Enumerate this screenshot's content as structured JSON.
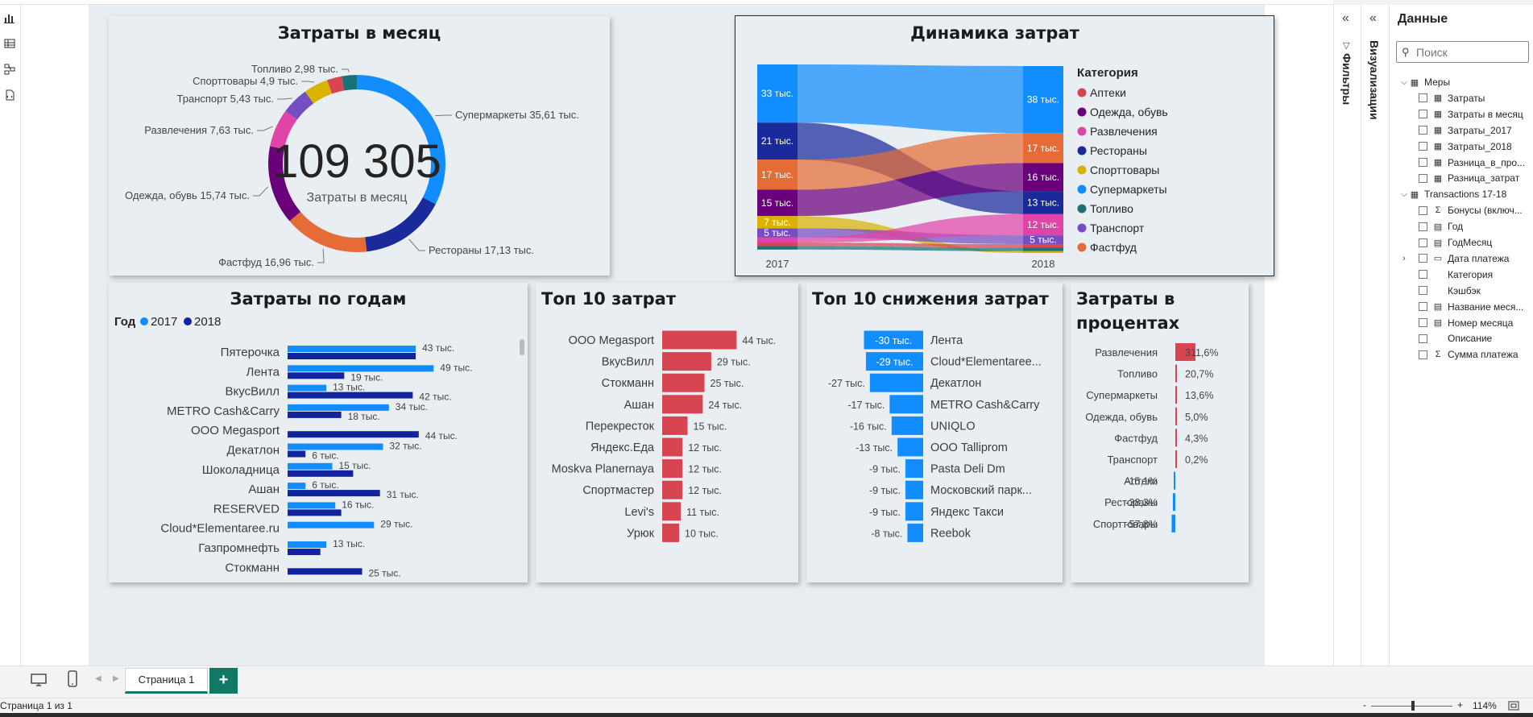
{
  "colors": {
    "Аптеки": "#d64550",
    "Одежда, обувь": "#6b007b",
    "Развлечения": "#e044a7",
    "Рестораны": "#1a2a9b",
    "Спорттовары": "#d9b300",
    "Супермаркеты": "#118dff",
    "Топливо": "#197278",
    "Транспорт": "#744ec2",
    "Фастфуд": "#e66c37",
    "y2017": "#118dff",
    "y2018": "#12239e",
    "top10": "#d64550",
    "decrease": "#118dff"
  },
  "donut": {
    "title": "Затраты в месяц",
    "total": "109 305",
    "subtitle": "Затраты в месяц",
    "slices": [
      {
        "category": "Супермаркеты",
        "value": 35.61,
        "label": "Супермаркеты 35,61 тыс."
      },
      {
        "category": "Рестораны",
        "value": 17.13,
        "label": "Рестораны 17,13 тыс."
      },
      {
        "category": "Фастфуд",
        "value": 16.96,
        "label": "Фастфуд 16,96 тыс."
      },
      {
        "category": "Одежда, обувь",
        "value": 15.74,
        "label": "Одежда, обувь 15,74 тыс."
      },
      {
        "category": "Развлечения",
        "value": 7.63,
        "label": "Развлечения 7,63 тыс."
      },
      {
        "category": "Транспорт",
        "value": 5.43,
        "label": "Транспорт 5,43 тыс."
      },
      {
        "category": "Спорттовары",
        "value": 4.9,
        "label": "Спорттовары 4,9 тыс."
      },
      {
        "category": "Аптеки",
        "value": 2.98,
        "label": ""
      },
      {
        "category": "Топливо",
        "value": 2.98,
        "label": "Топливо 2,98 тыс."
      }
    ]
  },
  "sankey": {
    "title": "Динамика затрат",
    "legend_title": "Категория",
    "legend": [
      "Аптеки",
      "Одежда, обувь",
      "Развлечения",
      "Рестораны",
      "Спорттовары",
      "Супермаркеты",
      "Топливо",
      "Транспорт",
      "Фастфуд"
    ],
    "year_left": "2017",
    "year_right": "2018",
    "left_nodes": [
      {
        "category": "Супермаркеты",
        "value": 33,
        "label": "33 тыс."
      },
      {
        "category": "Рестораны",
        "value": 21,
        "label": "21 тыс."
      },
      {
        "category": "Фастфуд",
        "value": 17,
        "label": "17 тыс."
      },
      {
        "category": "Одежда, обувь",
        "value": 15,
        "label": "15 тыс."
      },
      {
        "category": "Спорттовары",
        "value": 7,
        "label": "7 тыс."
      },
      {
        "category": "Транспорт",
        "value": 5,
        "label": "5 тыс."
      },
      {
        "category": "Развлечения",
        "value": 3,
        "label": ""
      },
      {
        "category": "Аптеки",
        "value": 2,
        "label": ""
      },
      {
        "category": "Топливо",
        "value": 2,
        "label": ""
      }
    ],
    "right_nodes": [
      {
        "category": "Супермаркеты",
        "value": 38,
        "label": "38 тыс."
      },
      {
        "category": "Фастфуд",
        "value": 17,
        "label": "17 тыс."
      },
      {
        "category": "Одежда, обувь",
        "value": 16,
        "label": "16 тыс."
      },
      {
        "category": "Рестораны",
        "value": 13,
        "label": "13 тыс."
      },
      {
        "category": "Развлечения",
        "value": 12,
        "label": "12 тыс."
      },
      {
        "category": "Транспорт",
        "value": 5,
        "label": "5 тыс."
      },
      {
        "category": "Аптеки",
        "value": 2,
        "label": ""
      },
      {
        "category": "Топливо",
        "value": 2,
        "label": ""
      },
      {
        "category": "Спорттовары",
        "value": 1,
        "label": ""
      }
    ]
  },
  "bars_years": {
    "title": "Затраты по годам",
    "legend_title": "Год",
    "legend": [
      "2017",
      "2018"
    ],
    "rows": [
      {
        "name": "Пятерочка",
        "v2017": 43,
        "l2017": "43 тыс.",
        "v2018": 43,
        "l2018": ""
      },
      {
        "name": "Лента",
        "v2017": 49,
        "l2017": "49 тыс.",
        "v2018": 19,
        "l2018": "19 тыс."
      },
      {
        "name": "ВкусВилл",
        "v2017": 13,
        "l2017": "13 тыс.",
        "v2018": 42,
        "l2018": "42 тыс."
      },
      {
        "name": "METRO Cash&Carry",
        "v2017": 34,
        "l2017": "34 тыс.",
        "v2018": 18,
        "l2018": "18 тыс."
      },
      {
        "name": "ООО Megasport",
        "v2017": 0,
        "l2017": "",
        "v2018": 44,
        "l2018": "44 тыс."
      },
      {
        "name": "Декатлон",
        "v2017": 32,
        "l2017": "32 тыс.",
        "v2018": 6,
        "l2018": "6 тыс."
      },
      {
        "name": "Шоколадница",
        "v2017": 15,
        "l2017": "15 тыс.",
        "v2018": 22,
        "l2018": ""
      },
      {
        "name": "Ашан",
        "v2017": 6,
        "l2017": "6 тыс.",
        "v2018": 31,
        "l2018": "31 тыс."
      },
      {
        "name": "RESERVED",
        "v2017": 16,
        "l2017": "16 тыс.",
        "v2018": 18,
        "l2018": ""
      },
      {
        "name": "Cloud*Elementaree.ru",
        "v2017": 29,
        "l2017": "29 тыс.",
        "v2018": 0,
        "l2018": ""
      },
      {
        "name": "Газпромнефть",
        "v2017": 13,
        "l2017": "13 тыс.",
        "v2018": 11,
        "l2018": ""
      },
      {
        "name": "Стокманн",
        "v2017": 0,
        "l2017": "",
        "v2018": 25,
        "l2018": "25 тыс."
      }
    ]
  },
  "top10": {
    "title": "Топ 10 затрат",
    "rows": [
      {
        "name": "ООО Megasport",
        "value": 44,
        "label": "44 тыс."
      },
      {
        "name": "ВкусВилл",
        "value": 29,
        "label": "29 тыс."
      },
      {
        "name": "Стокманн",
        "value": 25,
        "label": "25 тыс."
      },
      {
        "name": "Ашан",
        "value": 24,
        "label": "24 тыс."
      },
      {
        "name": "Перекресток",
        "value": 15,
        "label": "15 тыс."
      },
      {
        "name": "Яндекс.Еда",
        "value": 12,
        "label": "12 тыс."
      },
      {
        "name": "Moskva Planernaya",
        "value": 12,
        "label": "12 тыс."
      },
      {
        "name": "Спортмастер",
        "value": 12,
        "label": "12 тыс."
      },
      {
        "name": "Levi's",
        "value": 11,
        "label": "11 тыс."
      },
      {
        "name": "Урюк",
        "value": 10,
        "label": "10 тыс."
      }
    ]
  },
  "decrease": {
    "title": "Топ 10 снижения затрат",
    "rows": [
      {
        "name": "Лента",
        "value": -30,
        "label": "-30 тыс."
      },
      {
        "name": "Cloud*Elementaree...",
        "value": -29,
        "label": "-29 тыс."
      },
      {
        "name": "Декатлон",
        "value": -27,
        "label": "-27 тыс."
      },
      {
        "name": "METRO Cash&Carry",
        "value": -17,
        "label": "-17 тыс."
      },
      {
        "name": "UNIQLO",
        "value": -16,
        "label": "-16 тыс."
      },
      {
        "name": "ООО Talliprom",
        "value": -13,
        "label": "-13 тыс."
      },
      {
        "name": "Pasta Deli Dm",
        "value": -9,
        "label": "-9 тыс."
      },
      {
        "name": "Московский парк...",
        "value": -9,
        "label": "-9 тыс."
      },
      {
        "name": "Яндекс Такси",
        "value": -9,
        "label": "-9 тыс."
      },
      {
        "name": "Reebok",
        "value": -8,
        "label": "-8 тыс."
      }
    ]
  },
  "percent": {
    "title_line1": "Затраты в",
    "title_line2": "процентах",
    "rows": [
      {
        "name": "Развлечения",
        "value": 311.6,
        "label": "311,6%"
      },
      {
        "name": "Топливо",
        "value": 20.7,
        "label": "20,7%"
      },
      {
        "name": "Супермаркеты",
        "value": 13.6,
        "label": "13,6%"
      },
      {
        "name": "Одежда, обувь",
        "value": 5.0,
        "label": "5,0%"
      },
      {
        "name": "Фастфуд",
        "value": 4.3,
        "label": "4,3%"
      },
      {
        "name": "Транспорт",
        "value": 0.2,
        "label": "0,2%"
      },
      {
        "name": "Аптеки",
        "value": -15.1,
        "label": "-15,1%"
      },
      {
        "name": "Рестораны",
        "value": -38.3,
        "label": "-38,3%"
      },
      {
        "name": "Спорттовары",
        "value": -57.8,
        "label": "-57,8%"
      }
    ]
  },
  "chart_data": [
    {
      "type": "pie",
      "title": "Затраты в месяц",
      "categories": [
        "Супермаркеты",
        "Рестораны",
        "Фастфуд",
        "Одежда, обувь",
        "Развлечения",
        "Транспорт",
        "Спорттовары",
        "Аптеки",
        "Топливо"
      ],
      "values": [
        35.61,
        17.13,
        16.96,
        15.74,
        7.63,
        5.43,
        4.9,
        2.98,
        2.98
      ]
    },
    {
      "type": "bar",
      "title": "Затраты по годам",
      "categories": [
        "Пятерочка",
        "Лента",
        "ВкусВилл",
        "METRO Cash&Carry",
        "ООО Megasport",
        "Декатлон",
        "Шоколадница",
        "Ашан",
        "RESERVED",
        "Cloud*Elementaree.ru",
        "Газпромнефть",
        "Стокманн"
      ],
      "series": [
        {
          "name": "2017",
          "values": [
            43,
            49,
            13,
            34,
            0,
            32,
            15,
            6,
            16,
            29,
            13,
            0
          ]
        },
        {
          "name": "2018",
          "values": [
            43,
            19,
            42,
            18,
            44,
            6,
            22,
            31,
            18,
            0,
            11,
            25
          ]
        }
      ]
    },
    {
      "type": "bar",
      "title": "Топ 10 затрат",
      "categories": [
        "ООО Megasport",
        "ВкусВилл",
        "Стокманн",
        "Ашан",
        "Перекресток",
        "Яндекс.Еда",
        "Moskva Planernaya",
        "Спортмастер",
        "Levi's",
        "Урюк"
      ],
      "values": [
        44,
        29,
        25,
        24,
        15,
        12,
        12,
        12,
        11,
        10
      ]
    },
    {
      "type": "bar",
      "title": "Топ 10 снижения затрат",
      "categories": [
        "Лента",
        "Cloud*Elementaree...",
        "Декатлон",
        "METRO Cash&Carry",
        "UNIQLO",
        "ООО Talliprom",
        "Pasta Deli Dm",
        "Московский парк...",
        "Яндекс Такси",
        "Reebok"
      ],
      "values": [
        -30,
        -29,
        -27,
        -17,
        -16,
        -13,
        -9,
        -9,
        -9,
        -8
      ]
    },
    {
      "type": "bar",
      "title": "Затраты в процентах",
      "categories": [
        "Развлечения",
        "Топливо",
        "Супермаркеты",
        "Одежда, обувь",
        "Фастфуд",
        "Транспорт",
        "Аптеки",
        "Рестораны",
        "Спорттовары"
      ],
      "values": [
        311.6,
        20.7,
        13.6,
        5.0,
        4.3,
        0.2,
        -15.1,
        -38.3,
        -57.8
      ]
    }
  ],
  "panes": {
    "filters": "Фильтры",
    "viz": "Визуализации",
    "data_title": "Данные",
    "search_placeholder": "Поиск"
  },
  "tree": [
    {
      "label": "Меры",
      "kind": "folder"
    },
    {
      "label": "Затраты",
      "kind": "measure"
    },
    {
      "label": "Затраты в месяц",
      "kind": "measure"
    },
    {
      "label": "Затраты_2017",
      "kind": "measure"
    },
    {
      "label": "Затраты_2018",
      "kind": "measure"
    },
    {
      "label": "Разница_в_про...",
      "kind": "measure"
    },
    {
      "label": "Разница_затрат",
      "kind": "measure"
    },
    {
      "label": "Transactions 17-18",
      "kind": "table"
    },
    {
      "label": "Бонусы (включ...",
      "kind": "sum"
    },
    {
      "label": "Год",
      "kind": "calc"
    },
    {
      "label": "ГодМесяц",
      "kind": "calc"
    },
    {
      "label": "Дата платежа",
      "kind": "date"
    },
    {
      "label": "Категория",
      "kind": "field"
    },
    {
      "label": "Кэшбэк",
      "kind": "field"
    },
    {
      "label": "Название меся...",
      "kind": "calc"
    },
    {
      "label": "Номер месяца",
      "kind": "calc"
    },
    {
      "label": "Описание",
      "kind": "field"
    },
    {
      "label": "Сумма платежа",
      "kind": "sum"
    }
  ],
  "pages": {
    "tab_label": "Страница 1",
    "add_label": "+",
    "status": "Страница 1 из 1",
    "zoom": "114%",
    "zoom_minus": "-",
    "zoom_plus": "+"
  }
}
